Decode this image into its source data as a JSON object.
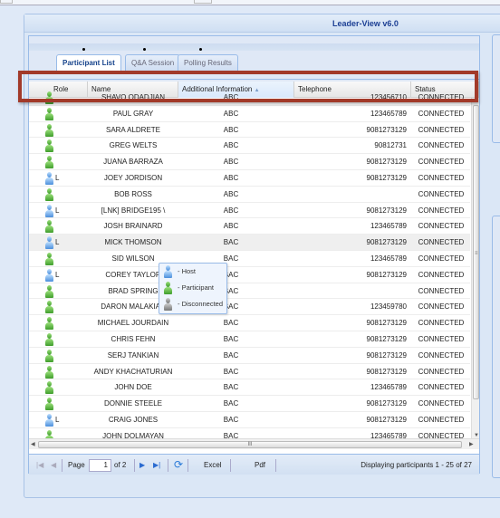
{
  "window": {
    "title": "Leader-View v6.0"
  },
  "tabs": [
    {
      "label": "Participant List",
      "active": true
    },
    {
      "label": "Q&A Session"
    },
    {
      "label": "Polling Results"
    }
  ],
  "columns": [
    {
      "label": "Role"
    },
    {
      "label": "Name"
    },
    {
      "label": "Additional Information",
      "sorted": "asc",
      "sort_icon": "sort-asc-icon"
    },
    {
      "label": "Telephone"
    },
    {
      "label": "Status"
    }
  ],
  "rows": [
    {
      "role": "participant",
      "flag": "",
      "name": "SHAVO ODADJIAN",
      "info": "ABC",
      "tel": "123456710",
      "status": "CONNECTED"
    },
    {
      "role": "participant",
      "flag": "",
      "name": "PAUL GRAY",
      "info": "ABC",
      "tel": "123465789",
      "status": "CONNECTED"
    },
    {
      "role": "participant",
      "flag": "",
      "name": "SARA ALDRETE",
      "info": "ABC",
      "tel": "9081273129",
      "status": "CONNECTED"
    },
    {
      "role": "participant",
      "flag": "",
      "name": "GREG WELTS",
      "info": "ABC",
      "tel": "90812731",
      "status": "CONNECTED"
    },
    {
      "role": "participant",
      "flag": "",
      "name": "JUANA BARRAZA",
      "info": "ABC",
      "tel": "9081273129",
      "status": "CONNECTED"
    },
    {
      "role": "host",
      "flag": "L",
      "name": "JOEY JORDISON",
      "info": "ABC",
      "tel": "9081273129",
      "status": "CONNECTED"
    },
    {
      "role": "participant",
      "flag": "",
      "name": "BOB ROSS",
      "info": "ABC",
      "tel": "",
      "status": "CONNECTED"
    },
    {
      "role": "host",
      "flag": "L",
      "name": "[LNK] BRIDGE195 \\",
      "info": "ABC",
      "tel": "9081273129",
      "status": "CONNECTED"
    },
    {
      "role": "participant",
      "flag": "",
      "name": "JOSH BRAINARD",
      "info": "ABC",
      "tel": "123465789",
      "status": "CONNECTED"
    },
    {
      "role": "host",
      "flag": "L",
      "name": "MICK THOMSON",
      "info": "BAC",
      "tel": "9081273129",
      "status": "CONNECTED",
      "selected": true
    },
    {
      "role": "participant",
      "flag": "",
      "name": "SID WILSON",
      "info": "BAC",
      "tel": "123465789",
      "status": "CONNECTED"
    },
    {
      "role": "host",
      "flag": "L",
      "name": "COREY TAYLOR",
      "info": "BAC",
      "tel": "9081273129",
      "status": "CONNECTED"
    },
    {
      "role": "participant",
      "flag": "",
      "name": "BRAD SPRING",
      "info": "BAC",
      "tel": "",
      "status": "CONNECTED"
    },
    {
      "role": "participant",
      "flag": "",
      "name": "DARON MALAKIAN",
      "info": "BAC",
      "tel": "123459780",
      "status": "CONNECTED"
    },
    {
      "role": "participant",
      "flag": "",
      "name": "MICHAEL JOURDAIN",
      "info": "BAC",
      "tel": "9081273129",
      "status": "CONNECTED"
    },
    {
      "role": "participant",
      "flag": "",
      "name": "CHRIS FEHN",
      "info": "BAC",
      "tel": "9081273129",
      "status": "CONNECTED"
    },
    {
      "role": "participant",
      "flag": "",
      "name": "SERJ TANKIAN",
      "info": "BAC",
      "tel": "9081273129",
      "status": "CONNECTED"
    },
    {
      "role": "participant",
      "flag": "",
      "name": "ANDY KHACHATURIAN",
      "info": "BAC",
      "tel": "9081273129",
      "status": "CONNECTED"
    },
    {
      "role": "participant",
      "flag": "",
      "name": "JOHN DOE",
      "info": "BAC",
      "tel": "123465789",
      "status": "CONNECTED"
    },
    {
      "role": "participant",
      "flag": "",
      "name": "DONNIE STEELE",
      "info": "BAC",
      "tel": "9081273129",
      "status": "CONNECTED"
    },
    {
      "role": "host",
      "flag": "L",
      "name": "CRAIG JONES",
      "info": "BAC",
      "tel": "9081273129",
      "status": "CONNECTED"
    },
    {
      "role": "participant",
      "flag": "",
      "name": "JOHN DOLMAYAN",
      "info": "BAC",
      "tel": "123465789",
      "status": "CONNECTED"
    }
  ],
  "legend": [
    {
      "role": "host",
      "label": "- Host"
    },
    {
      "role": "participant",
      "label": "- Participant"
    },
    {
      "role": "disconnected",
      "label": "- Disconnected"
    }
  ],
  "pager": {
    "page_label": "Page",
    "page_value": "1",
    "of_label": "of 2",
    "excel": "Excel",
    "pdf": "Pdf",
    "display": "Displaying participants 1 - 25 of 27"
  },
  "colors": {
    "host": "#4b8fdc",
    "participant": "#3f9d2c",
    "disconnected": "#777777",
    "highlight_box": "#a23a2a",
    "title": "#1c3f94"
  }
}
